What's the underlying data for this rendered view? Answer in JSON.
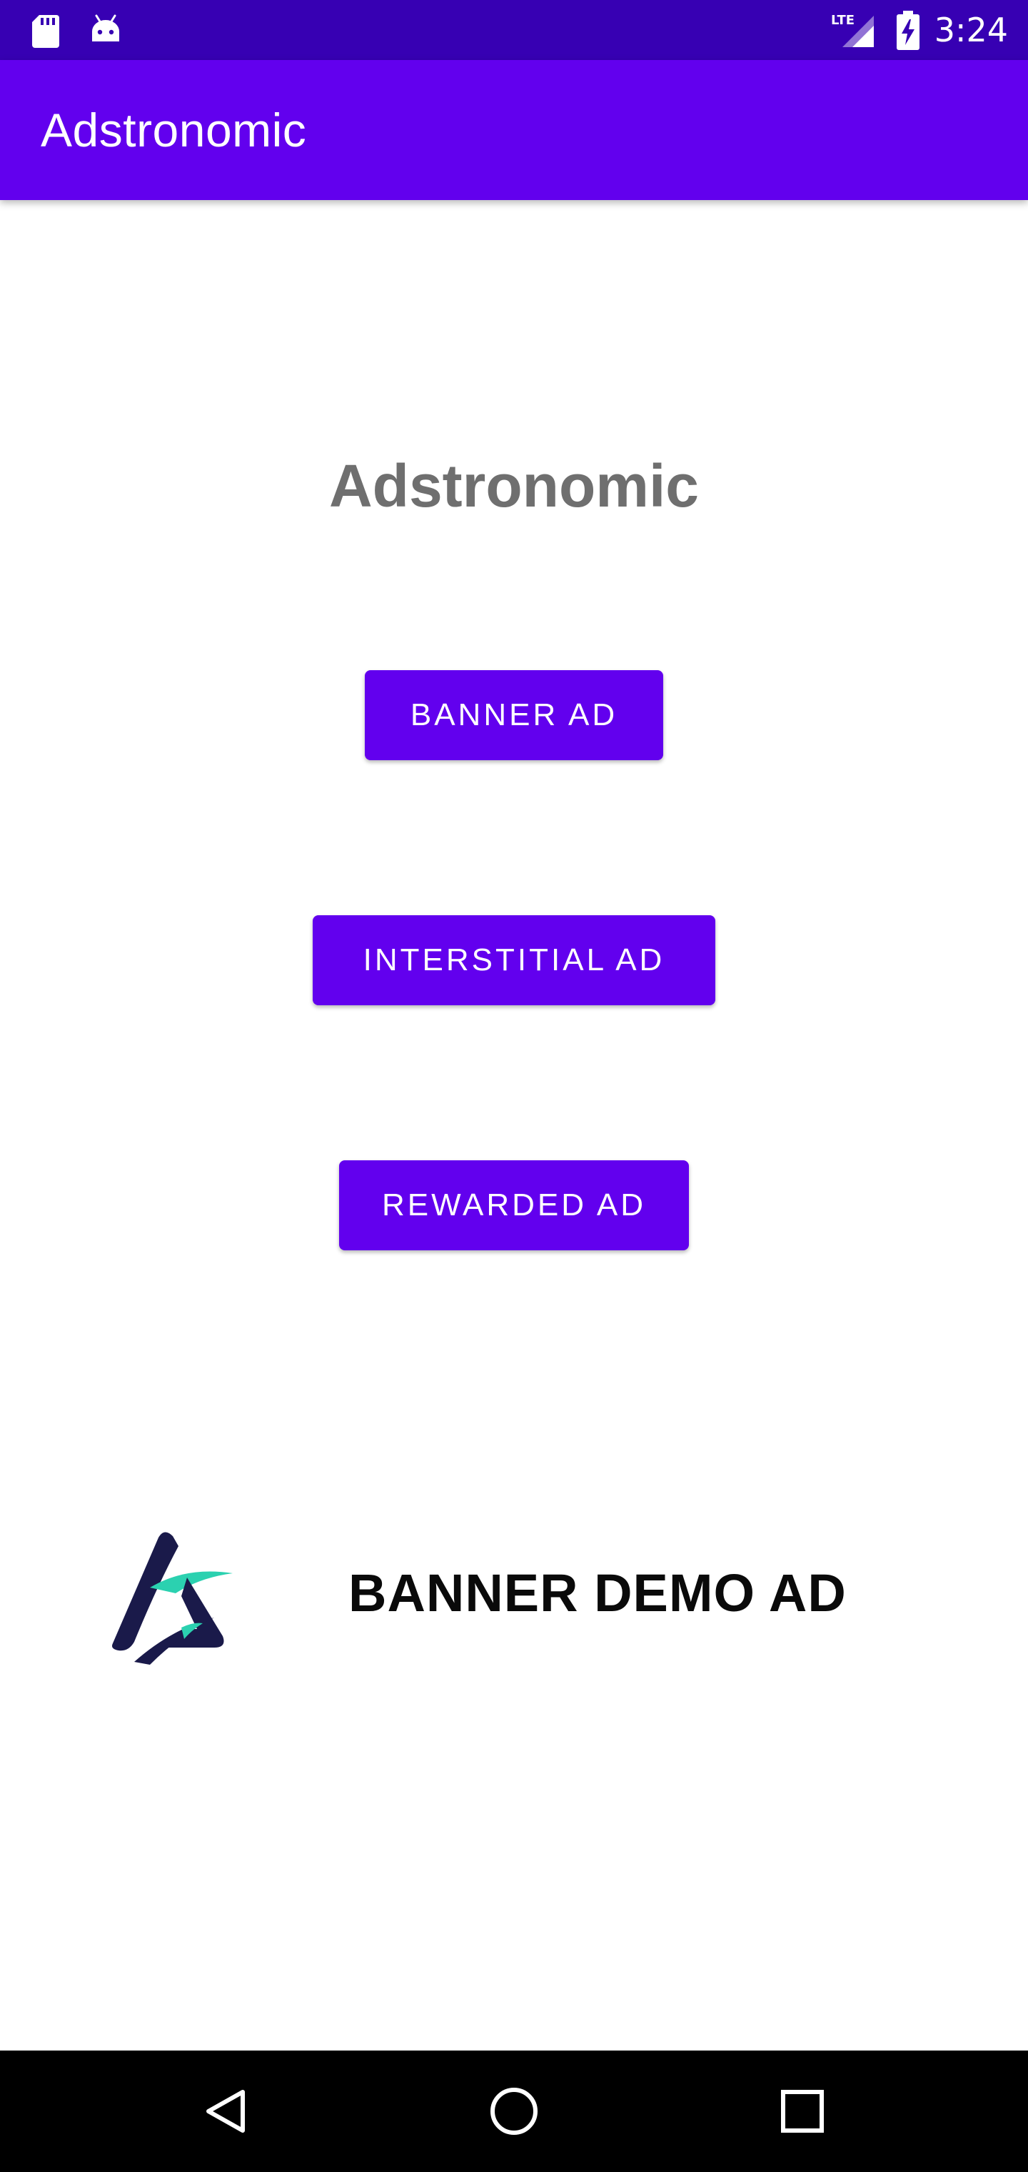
{
  "status_bar": {
    "time": "3:24",
    "network_label": "LTE",
    "icons": [
      "sd-card-icon",
      "android-debug-icon",
      "lte-signal-icon",
      "battery-charging-icon"
    ],
    "background": "#3700B3"
  },
  "app_bar": {
    "title": "Adstronomic",
    "background": "#6200EE"
  },
  "main": {
    "heading": "Adstronomic",
    "buttons": {
      "banner_label": "BANNER AD",
      "interstitial_label": "INTERSTITIAL AD",
      "rewarded_label": "REWARDED AD"
    },
    "accent_color": "#6200EE"
  },
  "banner_ad": {
    "text": "BANNER DEMO AD",
    "logo_icon": "adstronomic-logo-icon",
    "logo_colors": [
      "#1a1a4a",
      "#2bd1b0"
    ]
  },
  "nav_bar": {
    "icons": [
      "back-icon",
      "home-icon",
      "recents-icon"
    ]
  }
}
